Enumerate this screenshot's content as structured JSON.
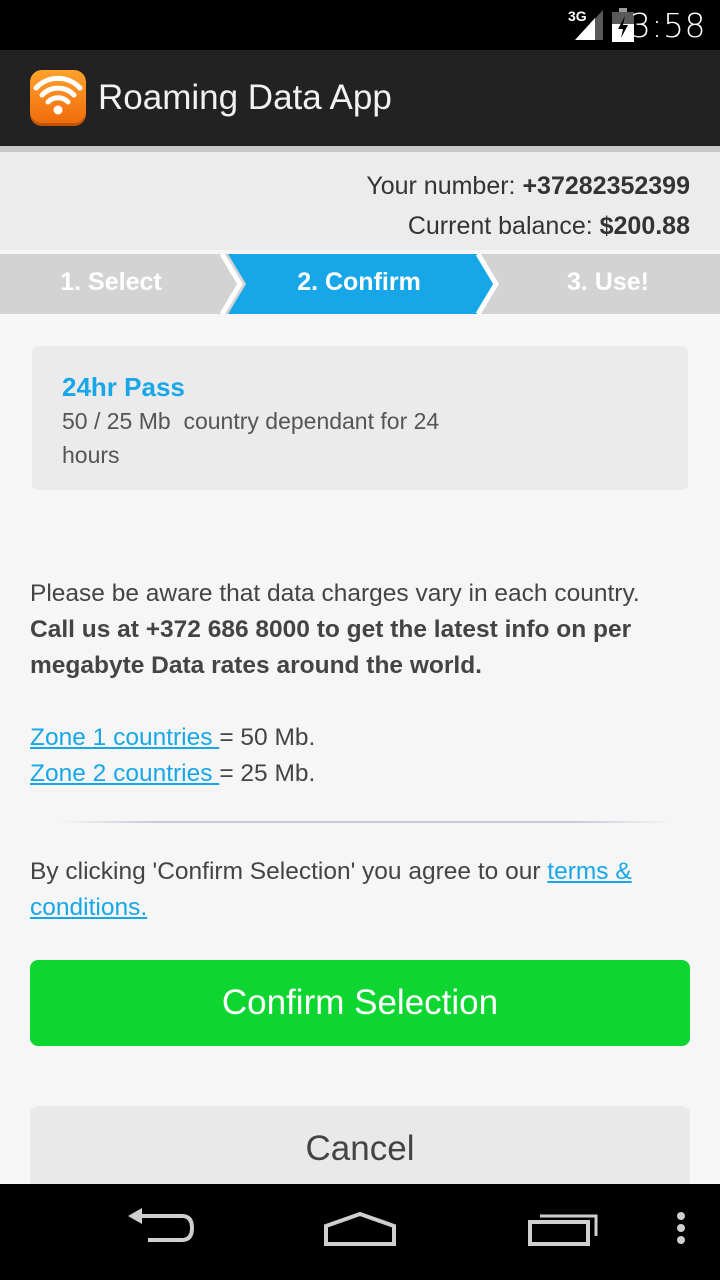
{
  "status_bar": {
    "network_type": "3G",
    "time": "3:58"
  },
  "app_bar": {
    "title": "Roaming Data App",
    "logo_icon": "wifi-icon"
  },
  "account": {
    "number_label": "Your number: ",
    "number": "+37282352399",
    "balance_label": "Current balance: ",
    "balance": "$200.88"
  },
  "steps": [
    {
      "label": "1. Select",
      "active": false
    },
    {
      "label": "2. Confirm",
      "active": true
    },
    {
      "label": "3. Use!",
      "active": false
    }
  ],
  "pass": {
    "name": "24hr Pass",
    "description": "50 / 25 Mb  country dependant for 24 hours"
  },
  "notice": {
    "text": "Please be aware that data charges vary in each country. ",
    "bold_text": "Call us at +372 686 8000 to get the latest info on per megabyte Data rates around the world."
  },
  "zones": [
    {
      "link": "Zone 1 countries ",
      "value": "= 50 Mb."
    },
    {
      "link": "Zone 2 countries ",
      "value": "= 25 Mb."
    }
  ],
  "terms": {
    "text": "By clicking 'Confirm Selection' you agree to our ",
    "link": "terms & conditions."
  },
  "buttons": {
    "confirm": "Confirm Selection",
    "cancel": "Cancel"
  },
  "colors": {
    "accent_blue": "#17a7e8",
    "confirm_green": "#0ed630",
    "app_bar": "#222222",
    "logo_orange": "#f7890f"
  }
}
